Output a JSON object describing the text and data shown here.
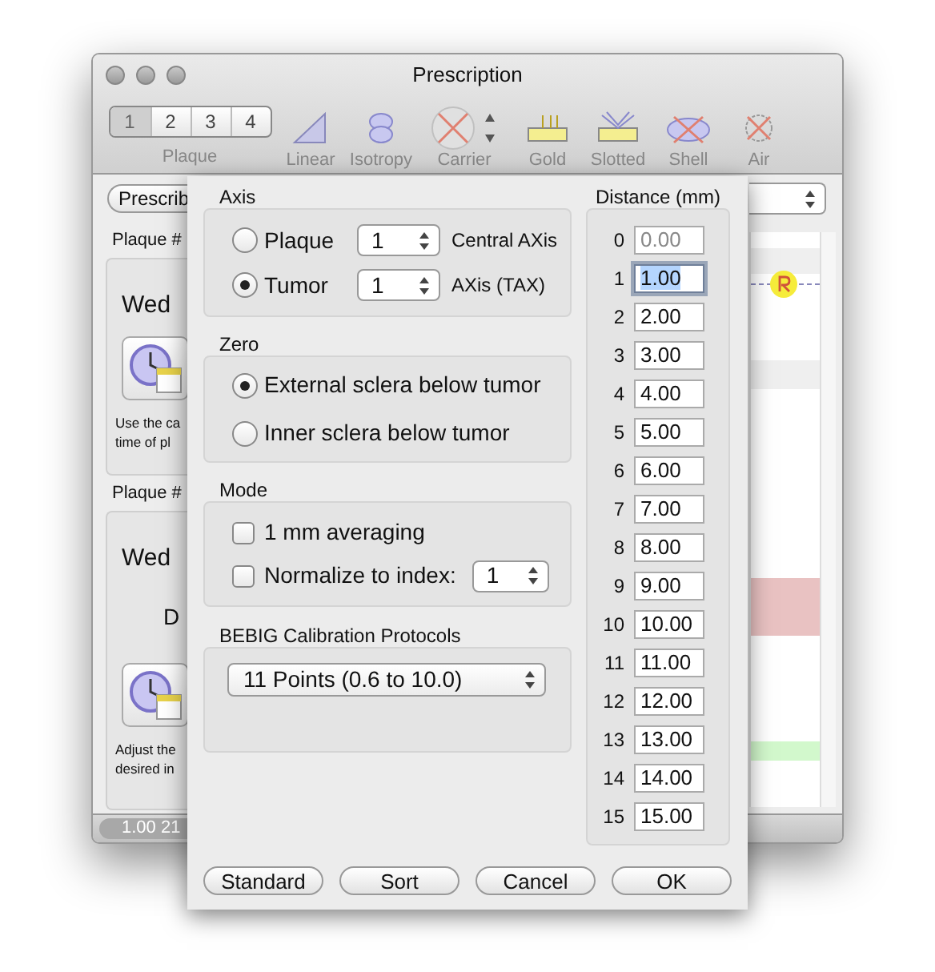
{
  "window": {
    "title": "Prescription"
  },
  "toolbar": {
    "plaque_segments": [
      {
        "label": "1",
        "selected": true
      },
      {
        "label": "2",
        "selected": false
      },
      {
        "label": "3",
        "selected": false
      },
      {
        "label": "4",
        "selected": false
      }
    ],
    "plaque_label": "Plaque",
    "tools": [
      {
        "kind": "linear",
        "label": "Linear"
      },
      {
        "kind": "isotropy",
        "label": "Isotropy"
      },
      {
        "kind": "carrier",
        "label": "Carrier"
      },
      {
        "kind": "gold",
        "label": "Gold"
      },
      {
        "kind": "slotted",
        "label": "Slotted"
      },
      {
        "kind": "shell",
        "label": "Shell"
      },
      {
        "kind": "air",
        "label": "Air"
      }
    ]
  },
  "background": {
    "prescribe_button": "Prescrib",
    "groups": [
      {
        "title": "Plaque #",
        "day": "Wed",
        "note_lines": [
          "Use the ca",
          "time of pl"
        ]
      },
      {
        "title": "Plaque #",
        "day": "Wed",
        "duration_label": "D",
        "note_lines": [
          "Adjust the",
          "desired in"
        ]
      }
    ],
    "status": "1.00 21"
  },
  "sheet": {
    "axis": {
      "title": "Axis",
      "options": [
        {
          "label": "Plaque",
          "selected": false,
          "stepper_value": "1",
          "description": "Central AXis"
        },
        {
          "label": "Tumor",
          "selected": true,
          "stepper_value": "1",
          "description": "AXis (TAX)"
        }
      ]
    },
    "zero": {
      "title": "Zero",
      "options": [
        {
          "label": "External sclera below tumor",
          "selected": true
        },
        {
          "label": "Inner sclera below tumor",
          "selected": false
        }
      ]
    },
    "mode": {
      "title": "Mode",
      "options": [
        {
          "label": "1 mm averaging",
          "checked": false
        },
        {
          "label": "Normalize to index:",
          "checked": false,
          "stepper_value": "1"
        }
      ]
    },
    "calibration": {
      "title": "BEBIG Calibration Protocols",
      "value": "11 Points (0.6 to 10.0)"
    },
    "distance": {
      "title": "Distance (mm)",
      "rows": [
        {
          "index": "0",
          "value": "0.00",
          "disabled": true,
          "focused": false
        },
        {
          "index": "1",
          "value": "1.00",
          "disabled": false,
          "focused": true
        },
        {
          "index": "2",
          "value": "2.00",
          "disabled": false,
          "focused": false
        },
        {
          "index": "3",
          "value": "3.00",
          "disabled": false,
          "focused": false
        },
        {
          "index": "4",
          "value": "4.00",
          "disabled": false,
          "focused": false
        },
        {
          "index": "5",
          "value": "5.00",
          "disabled": false,
          "focused": false
        },
        {
          "index": "6",
          "value": "6.00",
          "disabled": false,
          "focused": false
        },
        {
          "index": "7",
          "value": "7.00",
          "disabled": false,
          "focused": false
        },
        {
          "index": "8",
          "value": "8.00",
          "disabled": false,
          "focused": false
        },
        {
          "index": "9",
          "value": "9.00",
          "disabled": false,
          "focused": false
        },
        {
          "index": "10",
          "value": "10.00",
          "disabled": false,
          "focused": false
        },
        {
          "index": "11",
          "value": "11.00",
          "disabled": false,
          "focused": false
        },
        {
          "index": "12",
          "value": "12.00",
          "disabled": false,
          "focused": false
        },
        {
          "index": "13",
          "value": "13.00",
          "disabled": false,
          "focused": false
        },
        {
          "index": "14",
          "value": "14.00",
          "disabled": false,
          "focused": false
        },
        {
          "index": "15",
          "value": "15.00",
          "disabled": false,
          "focused": false
        }
      ]
    },
    "buttons": [
      "Standard",
      "Sort",
      "Cancel",
      "OK"
    ]
  }
}
